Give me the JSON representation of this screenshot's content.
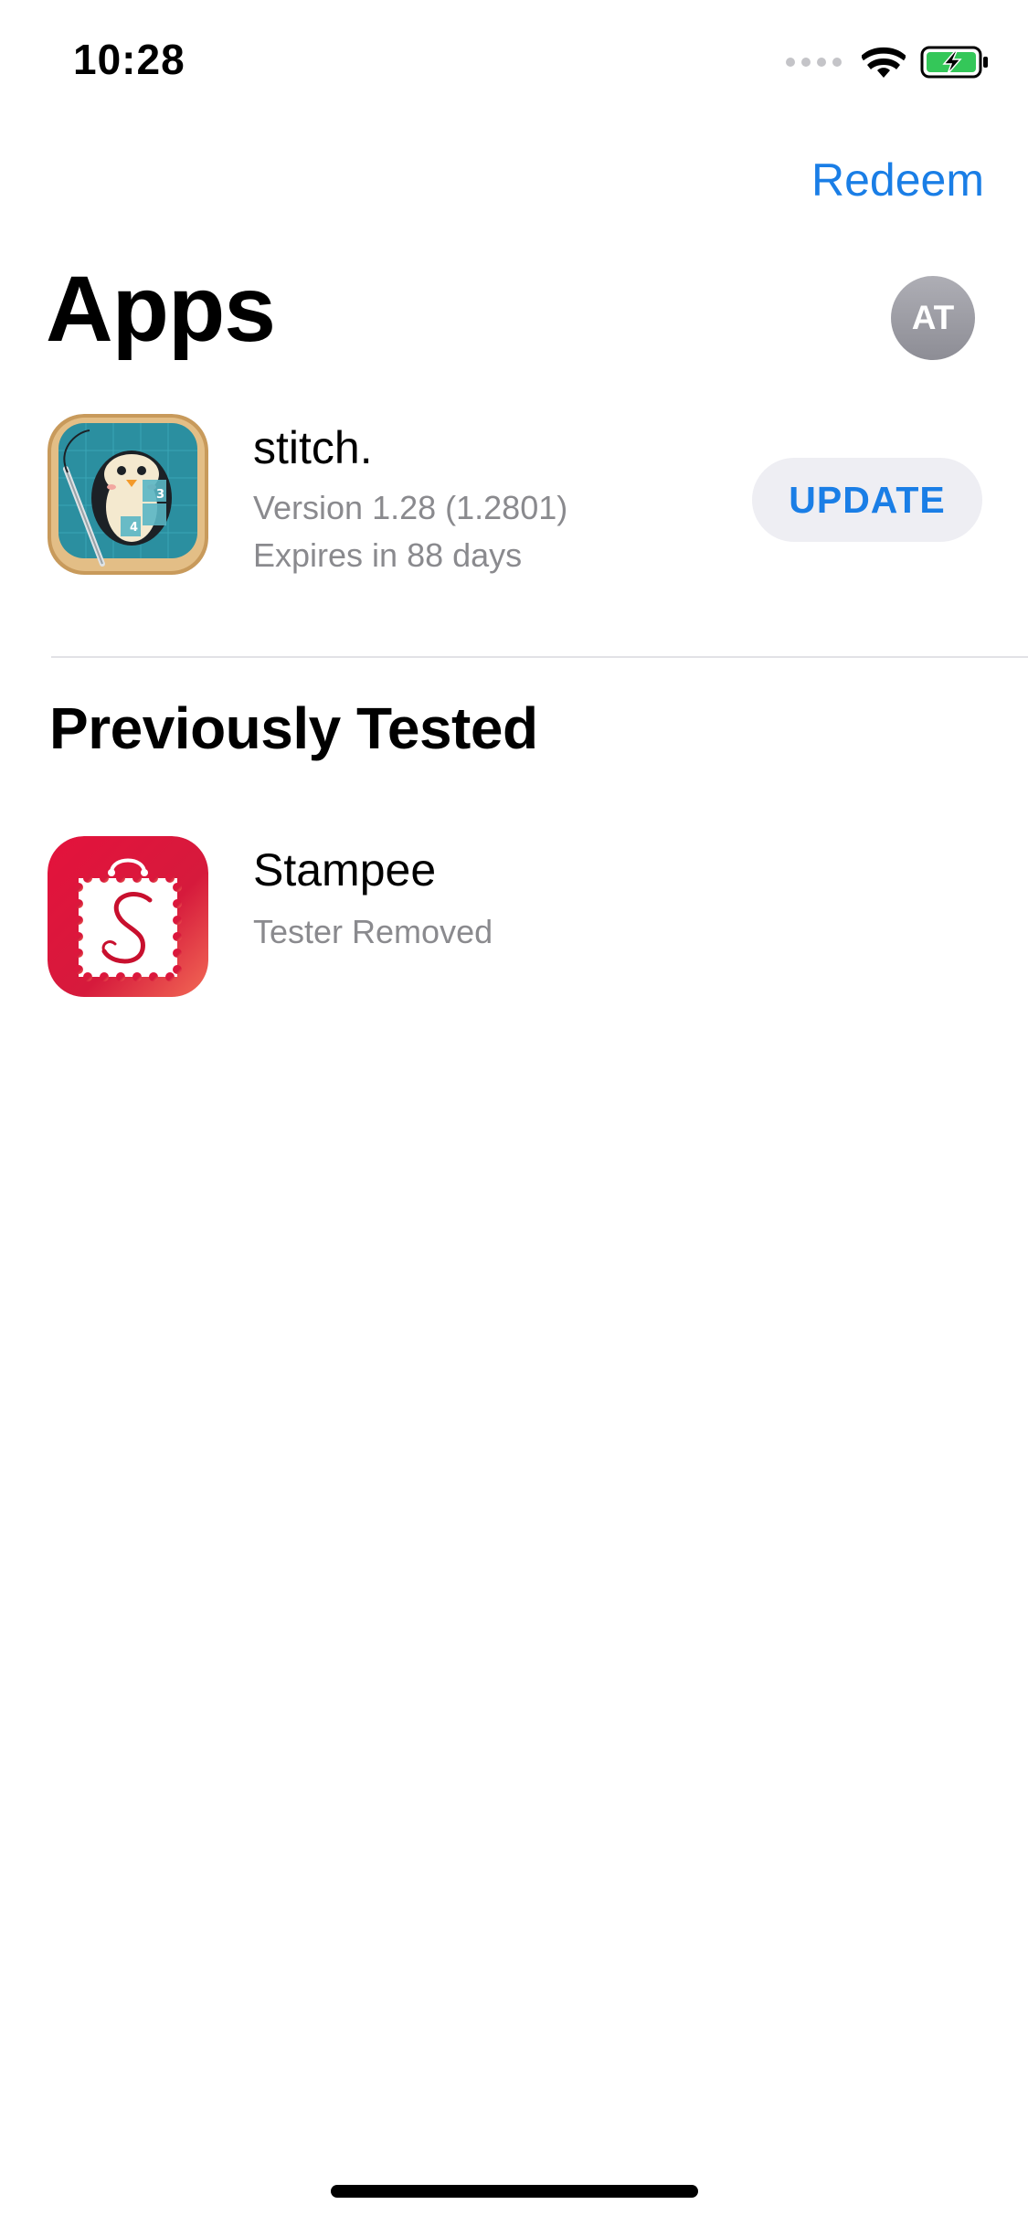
{
  "status_bar": {
    "time": "10:28",
    "icons": [
      "signal-dots-icon",
      "wifi-icon",
      "battery-charging-icon"
    ]
  },
  "header": {
    "redeem_label": "Redeem",
    "title": "Apps",
    "avatar_initials": "AT"
  },
  "apps": [
    {
      "name": "stitch.",
      "version": "Version 1.28 (1.2801)",
      "expires": "Expires in 88 days",
      "action_label": "UPDATE",
      "icon": "stitch-penguin-icon"
    }
  ],
  "previously_tested": {
    "title": "Previously Tested",
    "items": [
      {
        "name": "Stampee",
        "status": "Tester Removed",
        "icon": "stampee-stamp-icon"
      }
    ]
  },
  "colors": {
    "accent": "#1a7ee6",
    "secondary_text": "#8a8a8e",
    "button_bg": "#eeeef3",
    "battery_green": "#34c759",
    "stampee_red": "#d9143a"
  }
}
